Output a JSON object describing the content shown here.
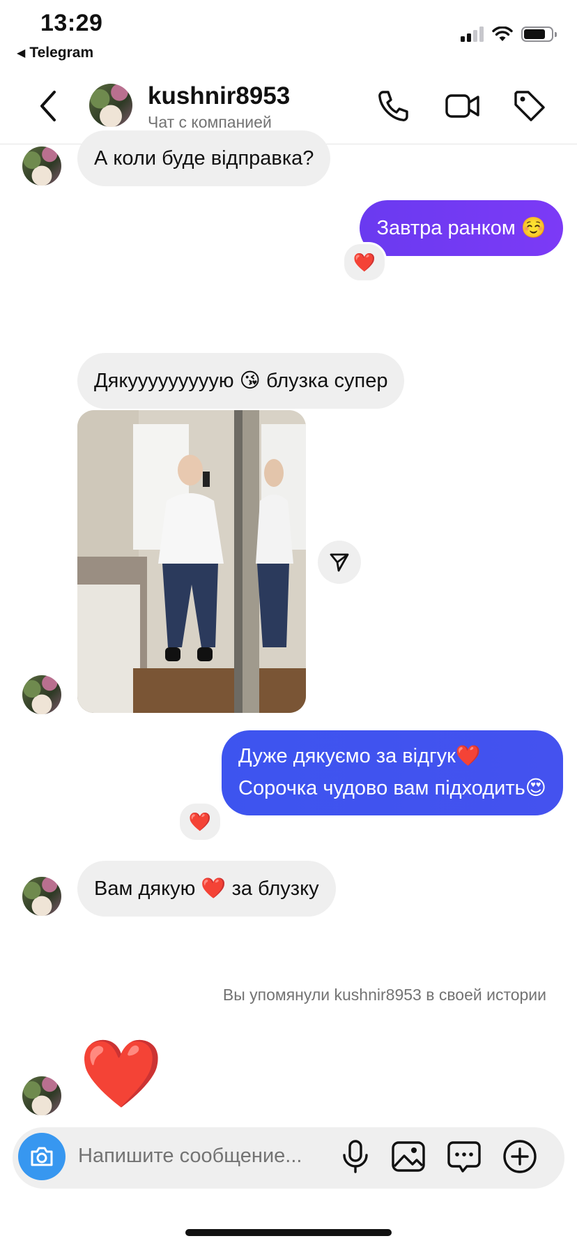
{
  "status_bar": {
    "time": "13:29",
    "back_app": "Telegram",
    "back_icon": "triangle-left-icon",
    "signal_icon": "cellular-signal-icon",
    "wifi_icon": "wifi-icon",
    "battery_icon": "battery-icon",
    "battery_level": 0.8
  },
  "header": {
    "back_icon": "chevron-left-icon",
    "avatar_icon": "profile-avatar",
    "username": "kushnir8953",
    "subtitle": "Чат с компанией",
    "actions": [
      {
        "name": "phone-call-button",
        "icon": "phone-icon"
      },
      {
        "name": "video-call-button",
        "icon": "video-camera-icon"
      },
      {
        "name": "tag-button",
        "icon": "tag-icon"
      }
    ]
  },
  "messages": [
    {
      "id": "m1",
      "direction": "incoming",
      "text": "А коли буде відправка?"
    },
    {
      "id": "m2",
      "direction": "outgoing",
      "text": "Завтра ранком ☺️",
      "reaction": "❤️"
    },
    {
      "id": "m3",
      "direction": "incoming",
      "text": "Дякууууууууую 😘 блузка супер"
    },
    {
      "id": "m4",
      "direction": "incoming",
      "type": "photo",
      "share_icon": "paper-plane-icon"
    },
    {
      "id": "m5",
      "direction": "outgoing",
      "lines": [
        "Дуже дякуємо за відгук❤️",
        "Сорочка чудово вам підходить😍"
      ],
      "reaction": "❤️"
    },
    {
      "id": "m6",
      "direction": "incoming",
      "text": "Вам дякую ❤️ за блузку"
    },
    {
      "id": "m7",
      "type": "system",
      "text": "Вы упомянули kushnir8953 в своей истории"
    },
    {
      "id": "m8",
      "direction": "incoming",
      "type": "emoji",
      "text": "❤️"
    }
  ],
  "composer": {
    "camera_icon": "camera-icon",
    "placeholder": "Напишите сообщение...",
    "actions": [
      {
        "name": "voice-message-button",
        "icon": "microphone-icon"
      },
      {
        "name": "gallery-button",
        "icon": "image-icon"
      },
      {
        "name": "sticker-button",
        "icon": "chat-bubble-dots-icon"
      },
      {
        "name": "add-button",
        "icon": "plus-circle-icon"
      }
    ]
  },
  "colors": {
    "outgoing_purple": "#6a3af0",
    "outgoing_blue": "#3d54ef",
    "incoming_bubble": "#efefef",
    "camera_blue": "#3797f0",
    "heart_red": "#ee1d3a"
  }
}
